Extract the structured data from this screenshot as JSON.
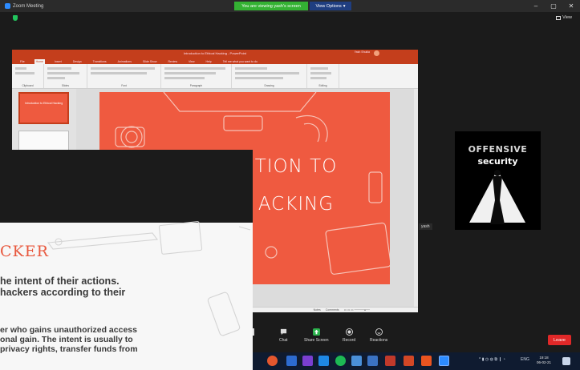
{
  "window": {
    "title": "Zoom Meeting",
    "viewing_banner": "You are viewing yash's screen",
    "view_options": "View Options",
    "view_button": "View"
  },
  "powerpoint": {
    "title_bar": "Introduction to Ethical Hacking - PowerPoint",
    "user": "Yash Shukla",
    "tabs": [
      "File",
      "Home",
      "Insert",
      "Design",
      "Transitions",
      "Animations",
      "Slide Show",
      "Review",
      "View",
      "Help",
      "Tell me what you want to do"
    ],
    "ribbon_groups": [
      "Clipboard",
      "Slides",
      "Font",
      "Paragraph",
      "Drawing",
      "Editing"
    ],
    "thumb1_text": "Introduction to Ethical Hacking",
    "slide_title_line1": "TION TO",
    "slide_title_line2": "ACKING",
    "status_notes": "Notes",
    "status_comments": "Comments"
  },
  "overlay_slide": {
    "heading": "CKER",
    "line1": "he intent of their actions.",
    "line2": "hackers according to their",
    "line3": "er who gains unauthorized access",
    "line4": "onal gain. The intent is usually to",
    "line5": "privacy rights, transfer funds from"
  },
  "participant": {
    "logo_line1": "OFFENSIVE",
    "logo_line2": "security",
    "name_label": "yash"
  },
  "toolbar": {
    "chat": "Chat",
    "share": "Share Screen",
    "record": "Record",
    "reactions": "Reactions",
    "leave": "Leave"
  },
  "taskbar": {
    "lang": "ENG",
    "time": "19:18",
    "date": "06-02-21"
  },
  "colors": {
    "slide_red": "#ef5a40",
    "ppt_accent": "#c43e1c",
    "banner_green": "#34b233",
    "leave_red": "#e02828"
  }
}
